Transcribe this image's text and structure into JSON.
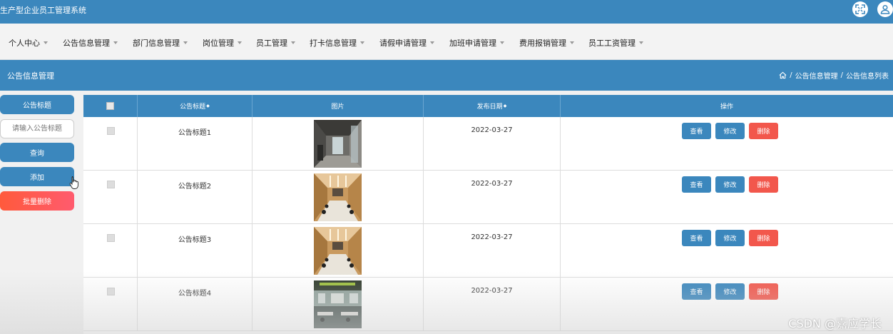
{
  "app": {
    "title": "生产型企业员工管理系统"
  },
  "header_icons": [
    "fullscreen-icon",
    "user-icon"
  ],
  "nav": {
    "items": [
      {
        "label": "个人中心"
      },
      {
        "label": "公告信息管理"
      },
      {
        "label": "部门信息管理"
      },
      {
        "label": "岗位管理"
      },
      {
        "label": "员工管理"
      },
      {
        "label": "打卡信息管理"
      },
      {
        "label": "请假申请管理"
      },
      {
        "label": "加班申请管理"
      },
      {
        "label": "费用报销管理"
      },
      {
        "label": "员工工资管理"
      }
    ]
  },
  "section": {
    "title": "公告信息管理",
    "breadcrumb": {
      "home_icon": "home-icon",
      "level1": "公告信息管理",
      "level2": "公告信息列表",
      "separator": "/"
    }
  },
  "sidebar": {
    "field_label": "公告标题",
    "search_placeholder": "请输入公告标题",
    "search_button": "查询",
    "add_button": "添加",
    "batch_delete_button": "批量删除"
  },
  "table": {
    "headers": {
      "title": "公告标题",
      "image": "图片",
      "date": "发布日期",
      "actions": "操作"
    },
    "sort_glyph": "◆",
    "rows": [
      {
        "title": "公告标题1",
        "date": "2022-03-27",
        "image": "office-corridor"
      },
      {
        "title": "公告标题2",
        "date": "2022-03-27",
        "image": "meeting-room"
      },
      {
        "title": "公告标题3",
        "date": "2022-03-27",
        "image": "meeting-room"
      },
      {
        "title": "公告标题4",
        "date": "2022-03-27",
        "image": "open-office"
      }
    ],
    "actions": {
      "view": "查看",
      "edit": "修改",
      "delete": "删除"
    }
  },
  "colors": {
    "primary": "#3b87bd",
    "view_edit": "#3b87bd",
    "delete": "#f2574c"
  },
  "watermark": "CSDN @嘉应学长"
}
